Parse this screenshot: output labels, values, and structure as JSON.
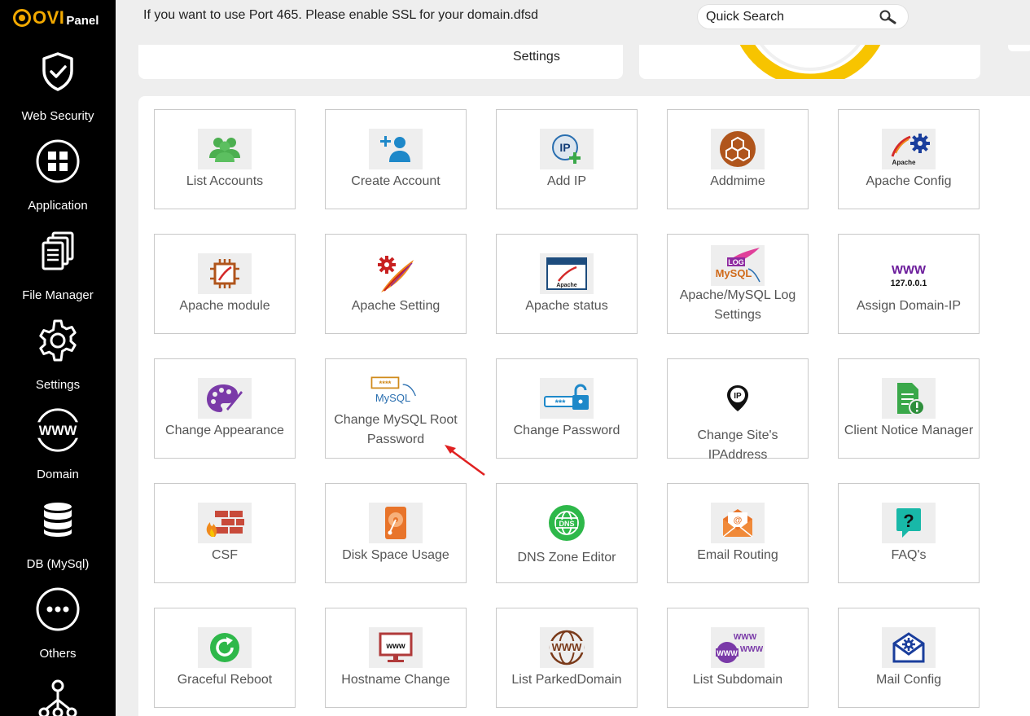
{
  "sidebar": {
    "logo": {
      "ovi": "OVI",
      "panel": "Panel"
    },
    "items": [
      {
        "label": "Web Security",
        "icon": "shield-check-icon"
      },
      {
        "label": "Application",
        "icon": "grid-apps-icon"
      },
      {
        "label": "File Manager",
        "icon": "files-icon"
      },
      {
        "label": "Settings",
        "icon": "gear-icon"
      },
      {
        "label": "Domain",
        "icon": "www-icon"
      },
      {
        "label": "DB (MySql)",
        "icon": "database-icon"
      },
      {
        "label": "Others",
        "icon": "more-dots-icon"
      },
      {
        "label": "",
        "icon": "network-icon"
      }
    ]
  },
  "topbar": {
    "notice": "If you want to use Port 465. Please enable SSL for your domain.dfsd",
    "search_placeholder": "Quick Search"
  },
  "cards": {
    "settings_label": "Settings"
  },
  "tiles": [
    {
      "label": "List Accounts",
      "icon": "users-group-icon"
    },
    {
      "label": "Create Account",
      "icon": "add-user-icon"
    },
    {
      "label": "Add IP",
      "icon": "add-ip-icon"
    },
    {
      "label": "Addmime",
      "icon": "boxes-icon"
    },
    {
      "label": "Apache Config",
      "icon": "apache-gear-icon"
    },
    {
      "label": "Apache module",
      "icon": "chip-icon"
    },
    {
      "label": "Apache Setting",
      "icon": "apache-feather-gear-icon"
    },
    {
      "label": "Apache status",
      "icon": "apache-window-icon"
    },
    {
      "label": "Apache/MySQL Log Settings",
      "icon": "log-mysql-icon"
    },
    {
      "label": "Assign Domain-IP",
      "icon": "www-ip-icon"
    },
    {
      "label": "Change Appearance",
      "icon": "palette-icon"
    },
    {
      "label": "Change MySQL Root Password",
      "icon": "mysql-password-icon"
    },
    {
      "label": "Change Password",
      "icon": "password-lock-icon"
    },
    {
      "label": "Change Site's IPAddress",
      "icon": "ip-pin-icon"
    },
    {
      "label": "Client Notice Manager",
      "icon": "notice-doc-icon"
    },
    {
      "label": "CSF",
      "icon": "firewall-icon"
    },
    {
      "label": "Disk Space Usage",
      "icon": "disk-icon"
    },
    {
      "label": "DNS Zone Editor",
      "icon": "dns-globe-icon"
    },
    {
      "label": "Email Routing",
      "icon": "email-routing-icon"
    },
    {
      "label": "FAQ's",
      "icon": "faq-icon"
    },
    {
      "label": "Graceful Reboot",
      "icon": "reboot-icon"
    },
    {
      "label": "Hostname Change",
      "icon": "monitor-www-icon"
    },
    {
      "label": "List ParkedDomain",
      "icon": "www-globe-icon"
    },
    {
      "label": "List Subdomain",
      "icon": "subdomain-www-icon"
    },
    {
      "label": "Mail Config",
      "icon": "mail-gear-icon"
    }
  ],
  "icon_texts": {
    "ip": "IP",
    "apache": "Apache",
    "log": "LOG",
    "mysql": "MySQL",
    "www": "WWW",
    "localhost": "127.0.0.1",
    "stars": "****",
    "pwd": "***",
    "dns": "DNS",
    "small_www": "www"
  },
  "colors": {
    "sidebar_bg": "#000000",
    "logo_accent": "#f2a900",
    "tile_border": "#c9c9c9",
    "arrow": "#e02020",
    "green_icon": "#4caf50",
    "orange_icon": "#e8742a"
  }
}
